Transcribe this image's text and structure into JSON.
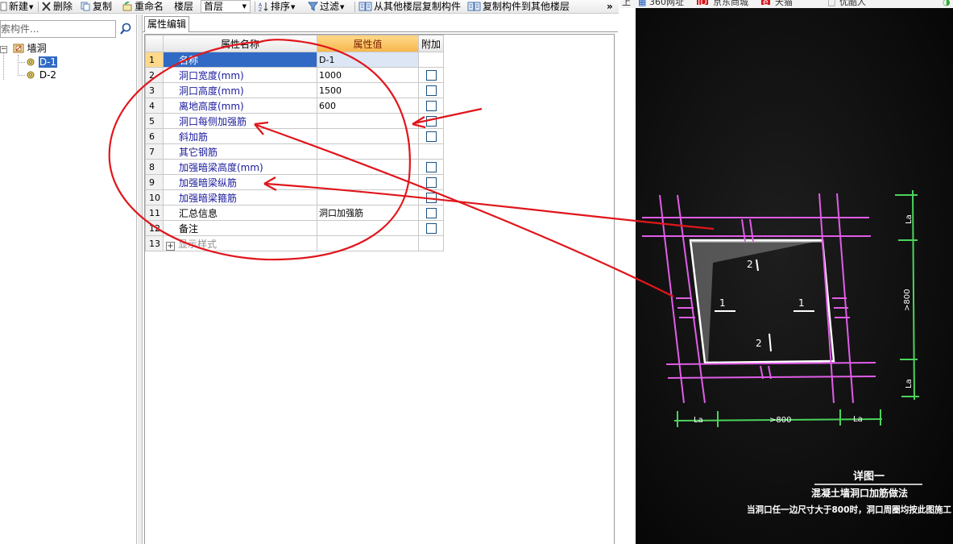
{
  "toolbar": {
    "new_label": "新建",
    "delete_label": "删除",
    "copy_label": "复制",
    "rename_label": "重命名",
    "floor_label": "楼层",
    "floor_value": "首层",
    "sort_label": "排序",
    "filter_label": "过滤",
    "copy_from_floor_label": "从其他楼层复制构件",
    "copy_to_floor_label": "复制构件到其他楼层",
    "more_label": "»"
  },
  "left_panel": {
    "search_placeholder": "索构件...",
    "tree": {
      "root_label": "墙洞",
      "children": [
        "D-1",
        "D-2"
      ]
    }
  },
  "properties": {
    "tab_label": "属性编辑",
    "columns": [
      "属性名称",
      "属性值",
      "附加"
    ],
    "rows": [
      {
        "num": "1",
        "name": "名称",
        "value": "D-1"
      },
      {
        "num": "2",
        "name": "洞口宽度(mm)",
        "value": "1000"
      },
      {
        "num": "3",
        "name": "洞口高度(mm)",
        "value": "1500"
      },
      {
        "num": "4",
        "name": "离地高度(mm)",
        "value": "600"
      },
      {
        "num": "5",
        "name": "洞口每侧加强筋",
        "value": ""
      },
      {
        "num": "6",
        "name": "斜加筋",
        "value": ""
      },
      {
        "num": "7",
        "name": "其它钢筋",
        "value": ""
      },
      {
        "num": "8",
        "name": "加强暗梁高度(mm)",
        "value": ""
      },
      {
        "num": "9",
        "name": "加强暗梁纵筋",
        "value": ""
      },
      {
        "num": "10",
        "name": "加强暗梁箍筋",
        "value": ""
      },
      {
        "num": "11",
        "name": "汇总信息",
        "value": "洞口加强筋"
      },
      {
        "num": "12",
        "name": "备注",
        "value": ""
      },
      {
        "num": "13",
        "name": "显示样式",
        "value": ""
      }
    ]
  },
  "browser_tabs": {
    "tab1": "360网址",
    "tab2": "京东商城",
    "tab3": "天猫",
    "tab4": "优酷人"
  },
  "drawing": {
    "title": "详图一",
    "subtitle": "混凝土墙洞口加筋做法",
    "note": "当洞口任一边尺寸大于800时，洞口周圈均按此图施工",
    "label_la": "La",
    "label_800": ">800",
    "label_1": "1",
    "label_2": "2"
  },
  "colors": {
    "annotation_red": "#e0161c",
    "selection_blue": "#316ac5",
    "value_header_orange": "#f6b64c",
    "drawing_magenta": "#e05de8",
    "drawing_green": "#4cd35c"
  }
}
